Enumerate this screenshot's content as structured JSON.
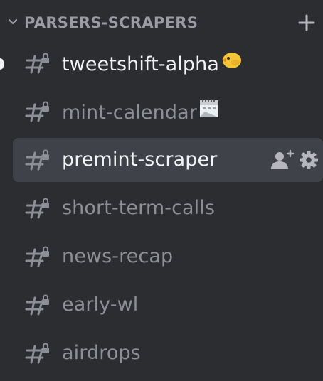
{
  "category": {
    "label": "PARSERS-SCRAPERS",
    "expanded": true,
    "chevron_icon": "chevron-down-icon",
    "add_icon": "plus-icon"
  },
  "channels": [
    {
      "name": "tweetshift-alpha",
      "emoji": "🐤",
      "icon": "locked-hash-icon",
      "state": "unread"
    },
    {
      "name": "mint-calendar",
      "emoji": "🗓️",
      "icon": "locked-hash-icon",
      "state": "read"
    },
    {
      "name": "premint-scraper",
      "emoji": "",
      "icon": "locked-hash-icon",
      "state": "selected"
    },
    {
      "name": "short-term-calls",
      "emoji": "",
      "icon": "locked-hash-icon",
      "state": "read"
    },
    {
      "name": "news-recap",
      "emoji": "",
      "icon": "locked-hash-icon",
      "state": "read"
    },
    {
      "name": "early-wl",
      "emoji": "",
      "icon": "locked-hash-icon",
      "state": "read"
    },
    {
      "name": "airdrops",
      "emoji": "",
      "icon": "locked-hash-icon",
      "state": "read"
    }
  ],
  "selected_channel_actions": {
    "invite_icon": "add-member-icon",
    "settings_icon": "gear-icon"
  },
  "colors": {
    "background": "#2b2d31",
    "selected_row": "#404249",
    "muted_text": "#8d8f96",
    "bright_text": "#f2f3f5",
    "category_text": "#9b9ca3"
  }
}
